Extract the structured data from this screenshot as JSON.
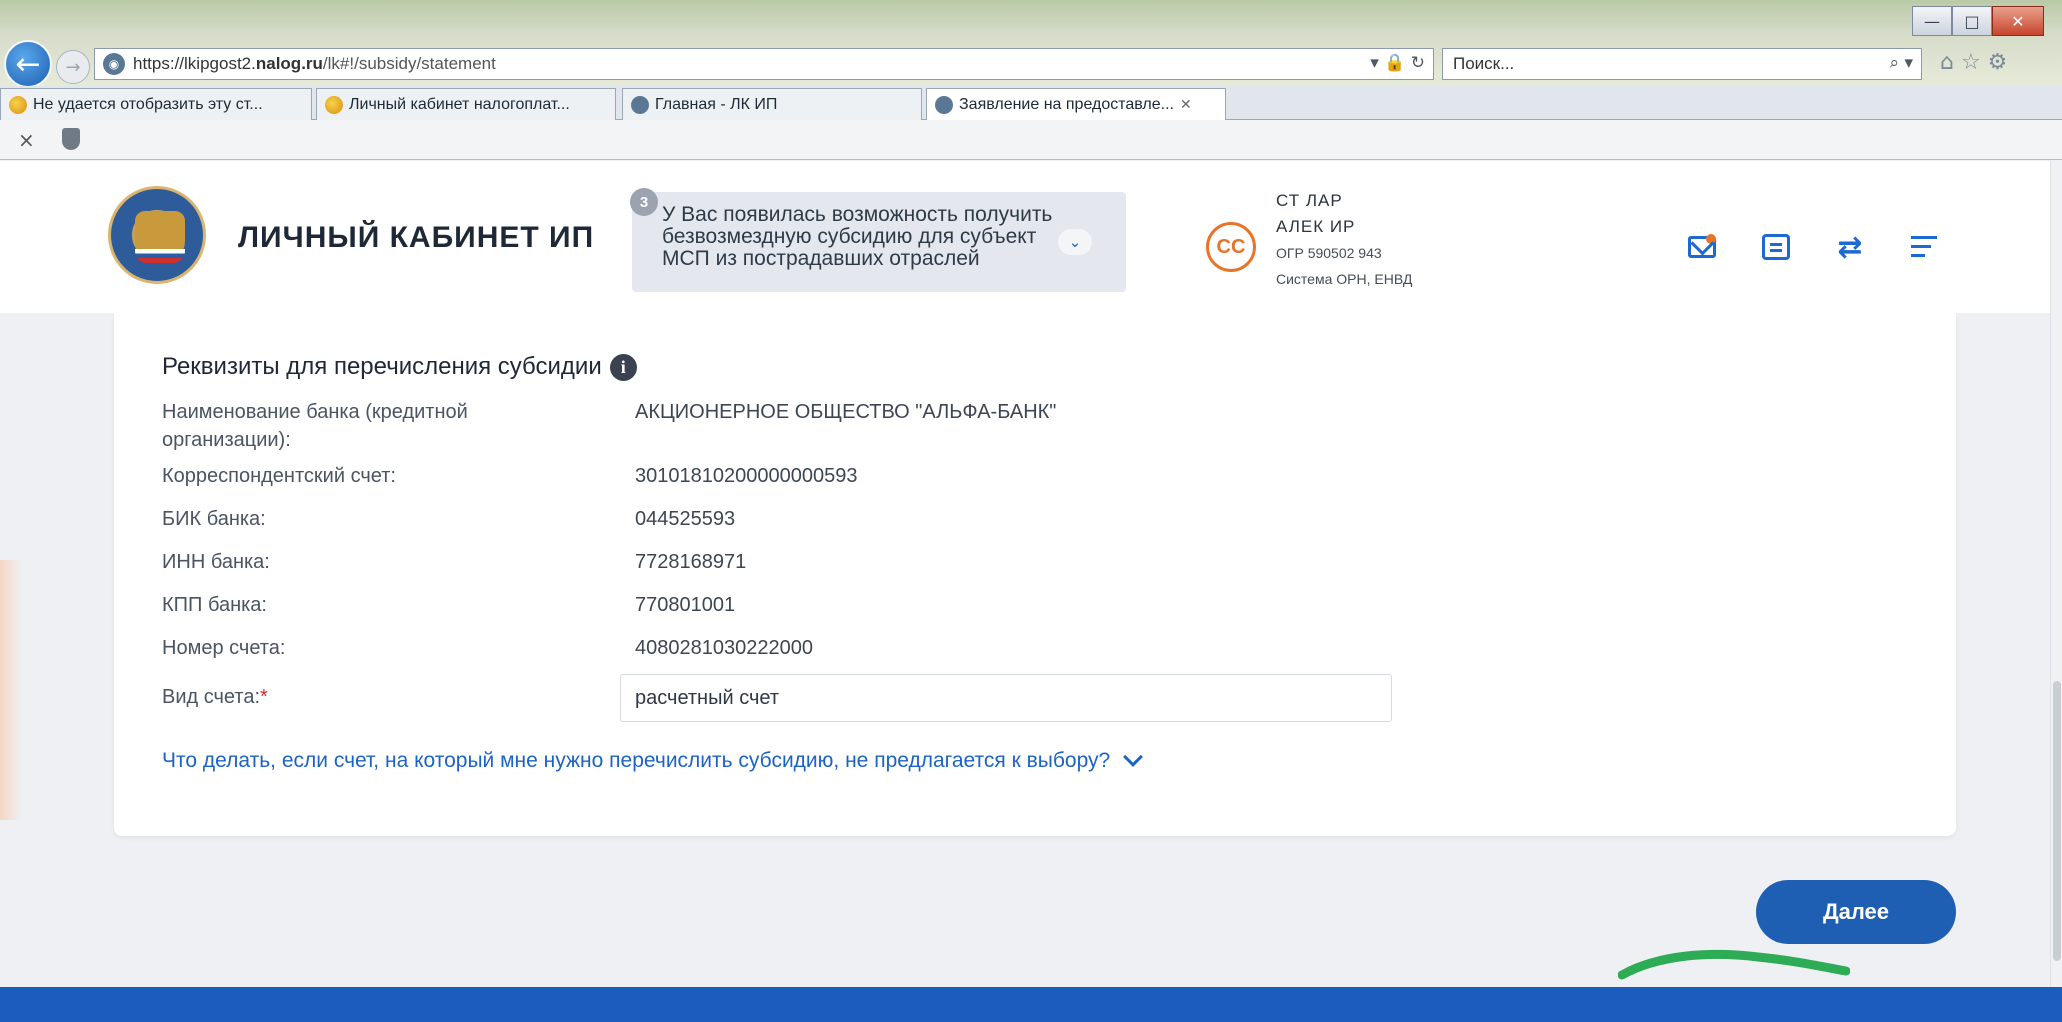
{
  "browser": {
    "url_prefix": "https://",
    "url_host_start": "lkipgost2.",
    "url_host_bold": "nalog.ru",
    "url_path": "/lk#!/subsidy/statement",
    "address_right_icons": "▾ 🔒 ↻",
    "search_placeholder": "Поиск...",
    "search_right_icons": "⌕ ▾",
    "toolbar_icons": "⌂ ☆ ⚙",
    "window_buttons": {
      "minimize": "—",
      "maximize": "□",
      "close": "✕"
    },
    "back_glyph": "←",
    "forward_glyph": "→",
    "command_close": "×",
    "tabs": [
      {
        "label": "Не удается отобразить эту ст...",
        "icon": "ie-icon",
        "active": false
      },
      {
        "label": "Личный кабинет налогоплат...",
        "icon": "ie-icon",
        "active": false
      },
      {
        "label": "Главная - ЛК ИП",
        "icon": "globe-icon",
        "active": false
      },
      {
        "label": "Заявление на предоставле...",
        "icon": "globe-icon",
        "active": true
      }
    ],
    "tab_close": "✕"
  },
  "header": {
    "site_title": "ЛИЧНЫЙ КАБИНЕТ ИП",
    "notice_badge": "3",
    "notice_line1": "У Вас появилась возможность получить",
    "notice_line2": "безвозмездную субсидию для субъект",
    "notice_line3": "МСП из пострадавших отраслей",
    "notice_chevron": "⌄",
    "avatar_initials": "СС",
    "user_line1": "СТ              ЛАР",
    "user_line2": "АЛЕК   ИР",
    "user_line3": "ОГР                          590502   943",
    "user_line4": "Система ОРН, ЕНВД",
    "swap_glyph": "⇄"
  },
  "section": {
    "title": "Реквизиты для перечисления субсидии",
    "info_glyph": "i",
    "rows": [
      {
        "label": "Наименование банка (кредитной",
        "label2": "организации):",
        "value": "АКЦИОНЕРНОЕ ОБЩЕСТВО \"АЛЬФА-БАНК\""
      },
      {
        "label": "Корреспондентский счет:",
        "value": "30101810200000000593"
      },
      {
        "label": "БИК банка:",
        "value": "044525593"
      },
      {
        "label": "ИНН банка:",
        "value": "7728168971"
      },
      {
        "label": "КПП банка:",
        "value": "770801001"
      },
      {
        "label": "Номер счета:",
        "value": "4080281030222000"
      }
    ],
    "account_type_label": "Вид счета:",
    "account_type_required": "*",
    "account_type_value": "расчетный счет",
    "faq_link": "Что делать, если счет, на который мне нужно перечислить субсидию, не предлагается к выбору?"
  },
  "actions": {
    "next_label": "Далее"
  },
  "colors": {
    "brand_blue": "#1e5fb3",
    "link_blue": "#1c64c4",
    "accent_orange": "#e8742a",
    "required_red": "#d32f2f",
    "marker_green": "#2eab55"
  }
}
